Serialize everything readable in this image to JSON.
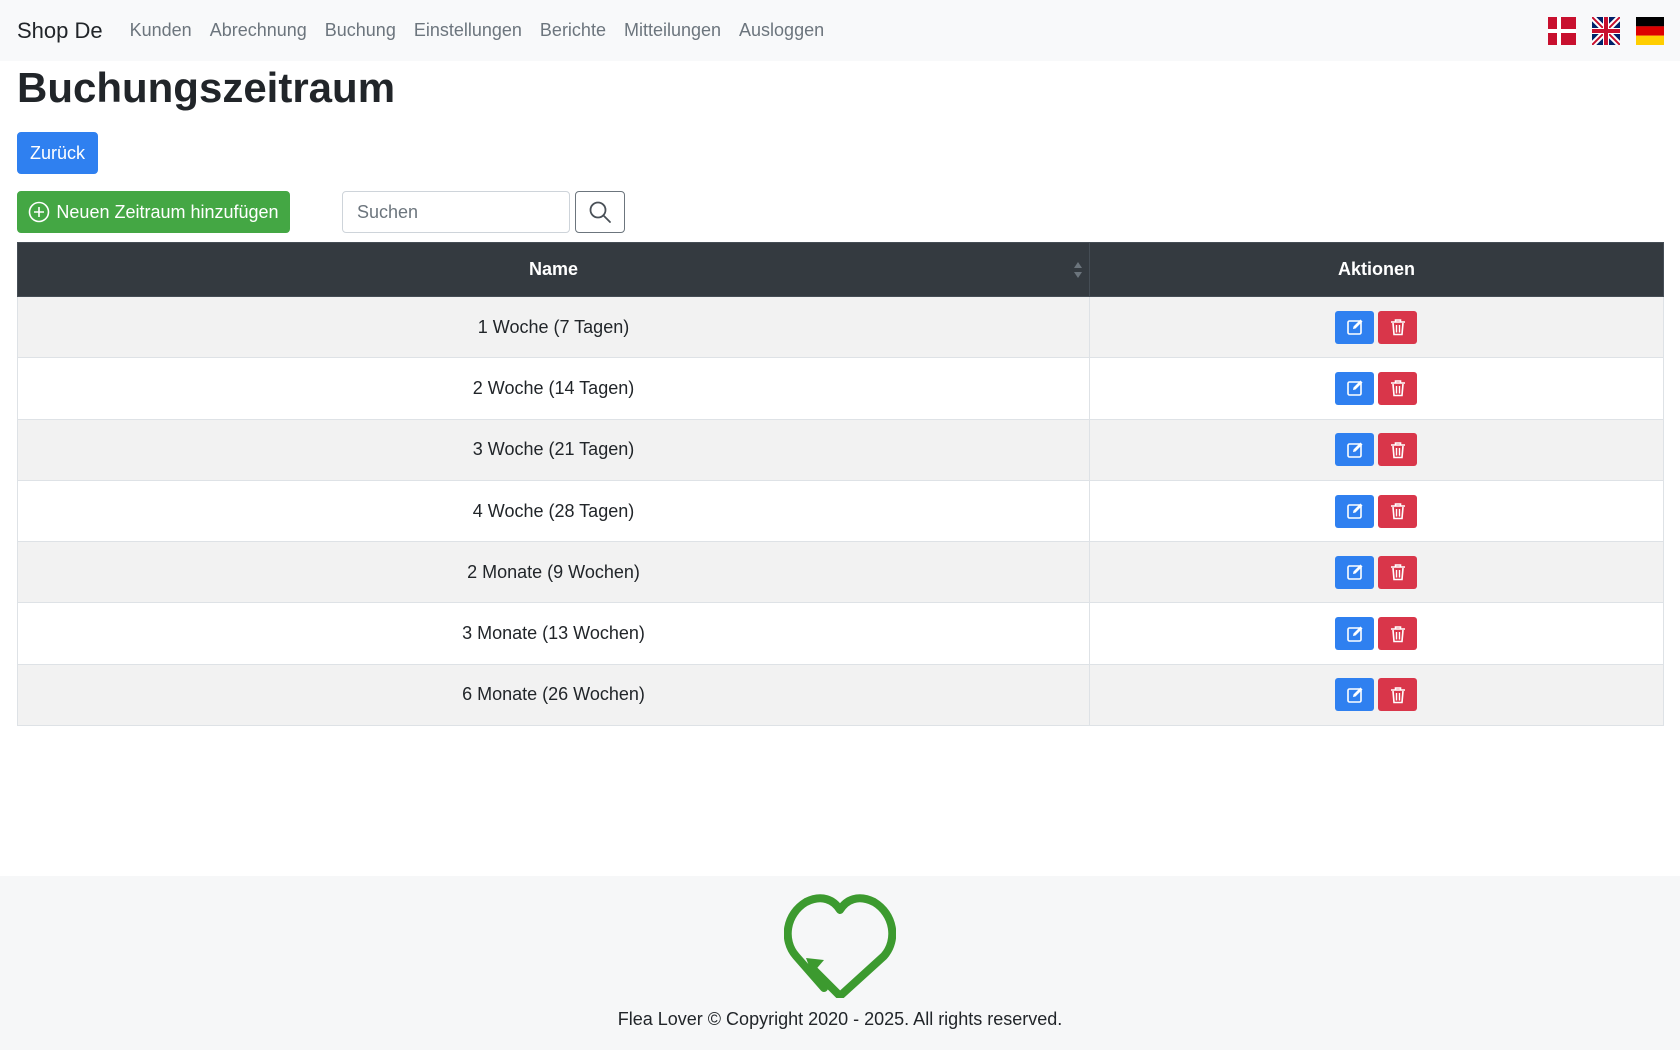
{
  "nav": {
    "brand": "Shop De",
    "links": [
      "Kunden",
      "Abrechnung",
      "Buchung",
      "Einstellungen",
      "Berichte",
      "Mitteilungen",
      "Ausloggen"
    ],
    "flags": [
      "Denmark flag",
      "United Kingdom flag",
      "Germany flag"
    ]
  },
  "page": {
    "title": "Buchungszeitraum",
    "back_label": "Zurück",
    "add_label": "Neuen Zeitraum hinzufügen",
    "search_placeholder": "Suchen"
  },
  "table": {
    "headers": [
      "Name",
      "Aktionen"
    ],
    "rows": [
      "1 Woche (7 Tagen)",
      "2 Woche (14 Tagen)",
      "3 Woche (21 Tagen)",
      "4 Woche (28 Tagen)",
      "2 Monate (9 Wochen)",
      "3 Monate (13 Wochen)",
      "6 Monate (26 Wochen)"
    ]
  },
  "footer": {
    "copyright": "Flea Lover © Copyright 2020 - 2025. All rights reserved."
  },
  "colors": {
    "primary": "#2f80f0",
    "success": "#44a744",
    "danger": "#d9364a",
    "header_dark": "#343a40",
    "logo_green": "#3c9a2f"
  }
}
